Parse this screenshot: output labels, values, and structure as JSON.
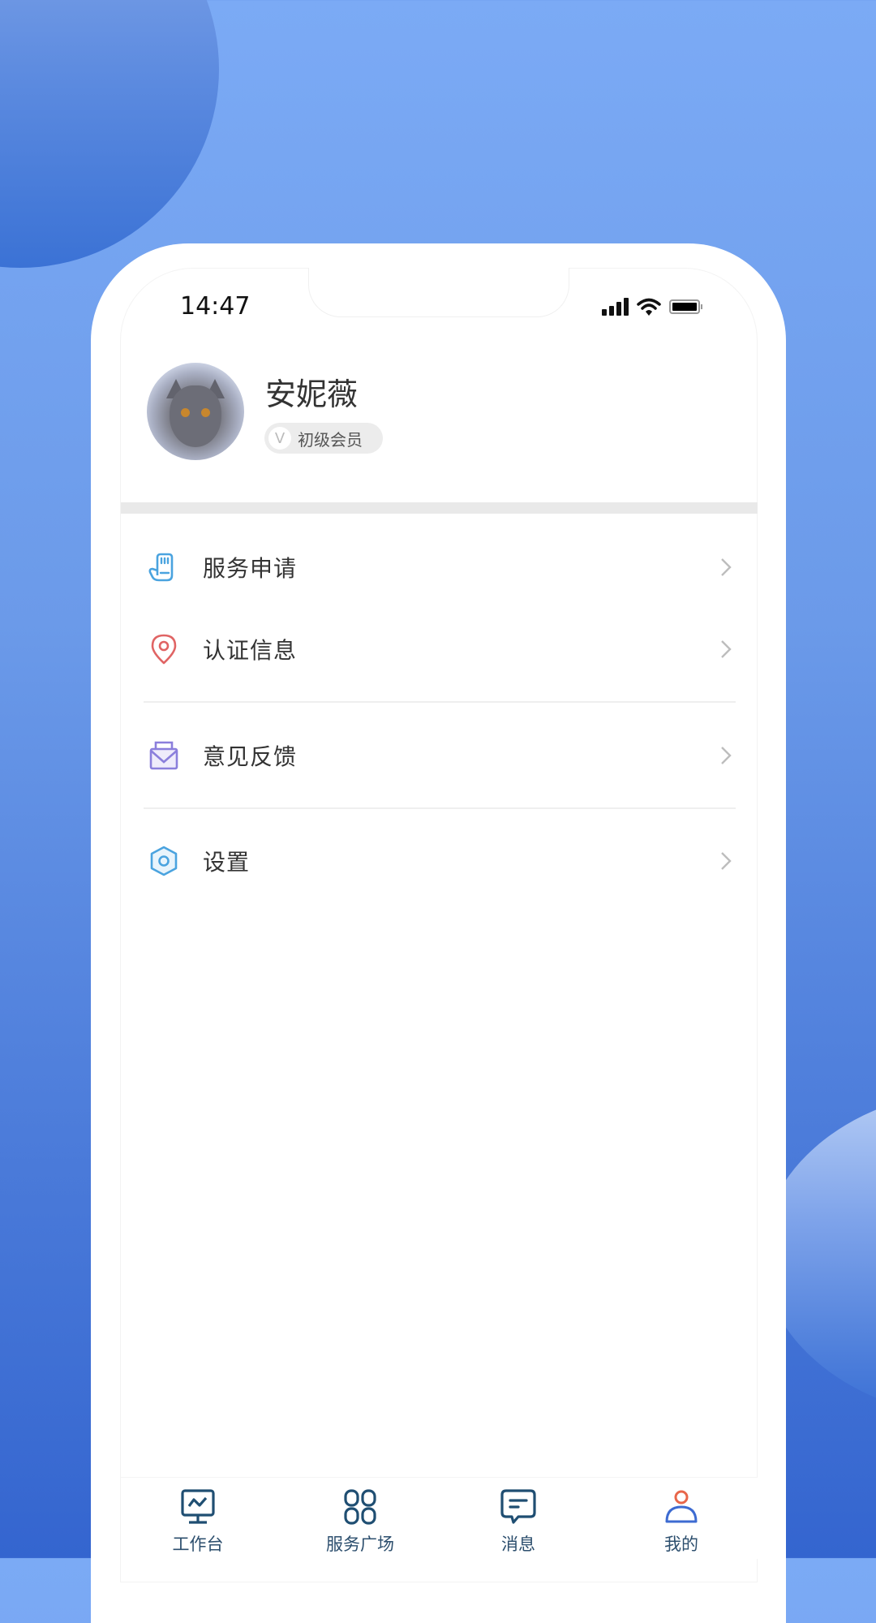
{
  "status_bar": {
    "time": "14:47",
    "icons": [
      "signal-icon",
      "wifi-icon",
      "battery-icon"
    ]
  },
  "profile": {
    "name": "安妮薇",
    "avatar": "cat-photo",
    "badge": {
      "icon": "V",
      "label": "初级会员"
    }
  },
  "menu": [
    {
      "label": "服务申请",
      "icon": "hand-icon",
      "color": "#4aa3df"
    },
    {
      "label": "认证信息",
      "icon": "location-pin-icon",
      "color": "#e06464"
    },
    {
      "label": "意见反馈",
      "icon": "envelope-icon",
      "color": "#8b7fdc"
    },
    {
      "label": "设置",
      "icon": "hexagon-settings-icon",
      "color": "#4aa3df"
    }
  ],
  "tabbar": {
    "items": [
      {
        "label": "工作台",
        "icon": "monitor-chart-icon",
        "active": false
      },
      {
        "label": "服务广场",
        "icon": "grid-icon",
        "active": false
      },
      {
        "label": "消息",
        "icon": "message-icon",
        "active": false
      },
      {
        "label": "我的",
        "icon": "user-icon",
        "active": true
      }
    ],
    "icon_color": "#1f4e72",
    "active_head_color": "#e8664a",
    "active_body_color": "#3d6bd1"
  },
  "colors": {
    "bg_top": "#7baaf5",
    "bg_bottom": "#3465cf",
    "text": "#333333",
    "separator": "#e9e9e9"
  }
}
